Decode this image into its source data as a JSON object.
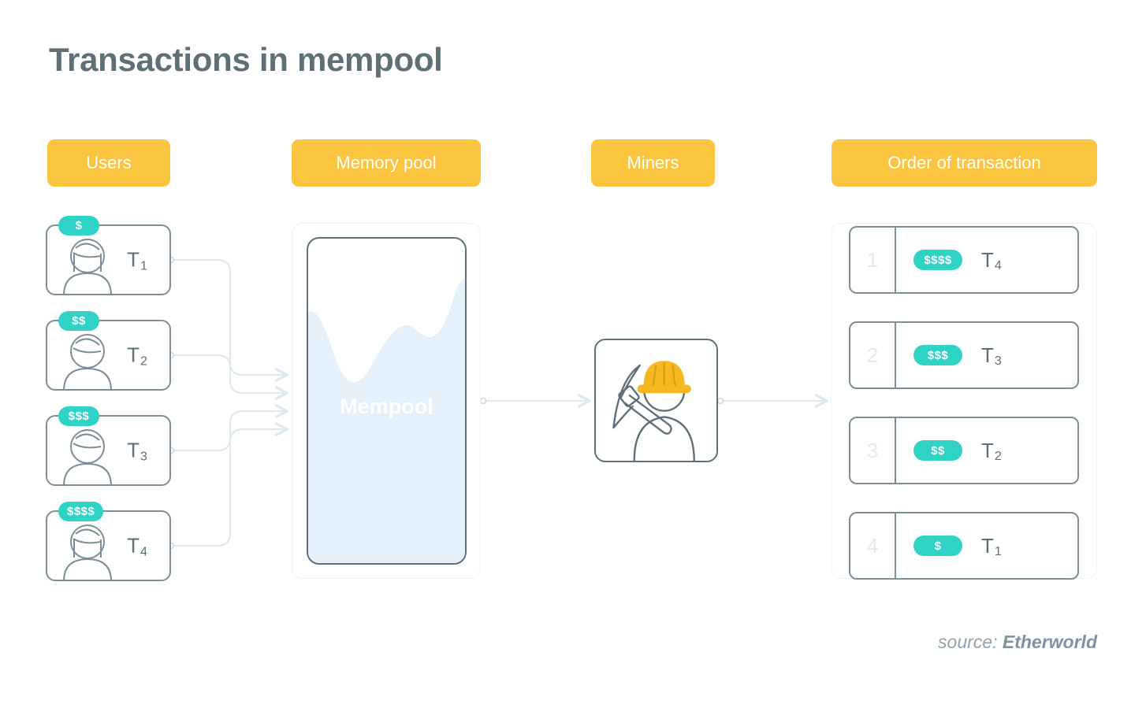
{
  "title": "Transactions in mempool",
  "colors": {
    "header_pill": "#fbc53f",
    "badge_teal": "#2ed3c6",
    "outline": "#5d7078",
    "liquid": "#e4f1fb",
    "connector": "#dce7ee",
    "helmet": "#f5b820"
  },
  "headers": {
    "users": "Users",
    "mempool": "Memory pool",
    "miners": "Miners",
    "order": "Order of transaction"
  },
  "users": [
    {
      "fee": "$",
      "tx": "T",
      "index": "1",
      "avatar": "avatar-long-hair-icon"
    },
    {
      "fee": "$$",
      "tx": "T",
      "index": "2",
      "avatar": "avatar-short-hair-icon"
    },
    {
      "fee": "$$$",
      "tx": "T",
      "index": "3",
      "avatar": "avatar-short-hair-icon"
    },
    {
      "fee": "$$$$",
      "tx": "T",
      "index": "4",
      "avatar": "avatar-long-hair-icon"
    }
  ],
  "mempool": {
    "label": "Mempool"
  },
  "miner": {
    "icon": "miner-with-pickaxe-icon"
  },
  "order": [
    {
      "rank": "1",
      "fee": "$$$$",
      "tx": "T",
      "index": "4"
    },
    {
      "rank": "2",
      "fee": "$$$",
      "tx": "T",
      "index": "3"
    },
    {
      "rank": "3",
      "fee": "$$",
      "tx": "T",
      "index": "2"
    },
    {
      "rank": "4",
      "fee": "$",
      "tx": "T",
      "index": "1"
    }
  ],
  "source": {
    "prefix": "source: ",
    "name": "Etherworld"
  }
}
